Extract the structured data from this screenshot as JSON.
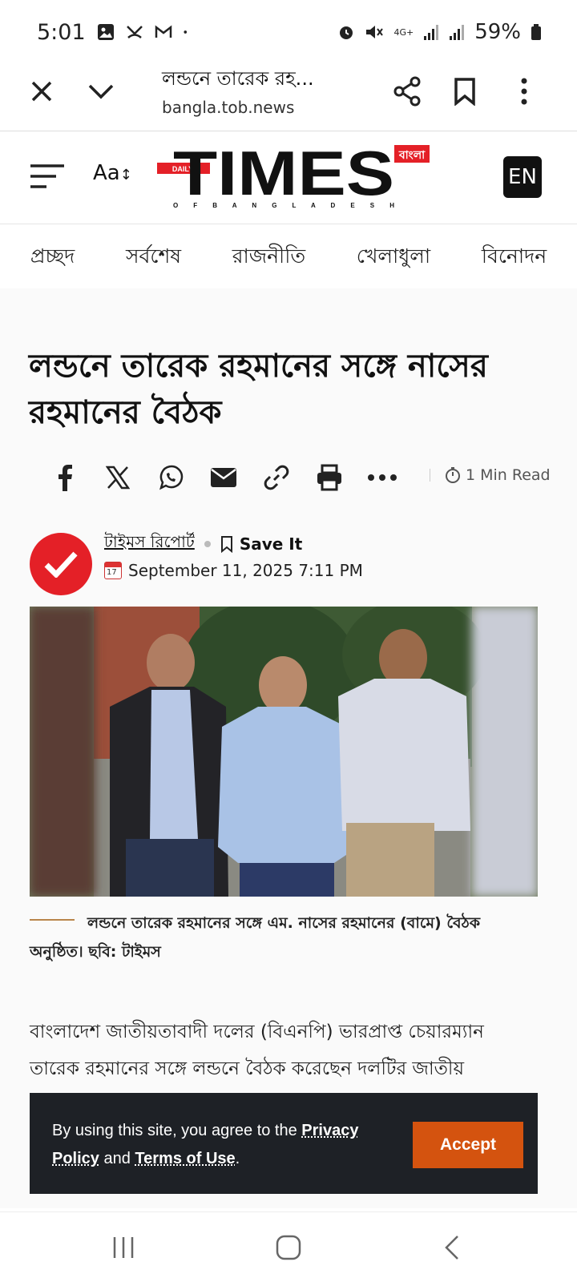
{
  "status": {
    "time": "5:01",
    "network": "4G+",
    "battery": "59%"
  },
  "browser": {
    "title": "লন্ডনে তারেক রহ...",
    "url": "bangla.tob.news"
  },
  "site": {
    "font_size_label": "Aa",
    "logo_daily": "DAILY",
    "logo_main": "TIMES",
    "logo_bangla": "বাংলা",
    "logo_sub": "O F   B A N G L A D E S H",
    "lang_button": "EN"
  },
  "categories": [
    "প্রচ্ছদ",
    "সর্বশেষ",
    "রাজনীতি",
    "খেলাধুলা",
    "বিনোদন"
  ],
  "article": {
    "headline": "লন্ডনে তারেক রহমানের সঙ্গে নাসের রহমানের বৈঠক",
    "read_time": "1 Min Read",
    "author": "টাইমস রিপোর্ট",
    "save_label": "Save It",
    "calendar_day": "17",
    "date": "September 11, 2025 7:11 PM",
    "caption": "লন্ডনে তারেক রহমানের সঙ্গে এম. নাসের রহমানের (বামে) বৈঠক অনুষ্ঠিত। ছবি: টাইমস",
    "body": "বাংলাদেশ জাতীয়তাবাদী দলের (বিএনপি) ভারপ্রাপ্ত চেয়ারম্যান তারেক রহমানের সঙ্গে লন্ডনে বৈঠক করেছেন দলটির জাতীয়"
  },
  "cookie": {
    "text_before": "By using this site, you agree to the ",
    "privacy_link": "Privacy Policy",
    "text_and": " and ",
    "terms_link": "Terms of Use",
    "text_end": ".",
    "accept_label": "Accept"
  },
  "colors": {
    "brand_red": "#e42027",
    "accept_orange": "#d4530f",
    "cookie_bg": "#1e2126"
  }
}
